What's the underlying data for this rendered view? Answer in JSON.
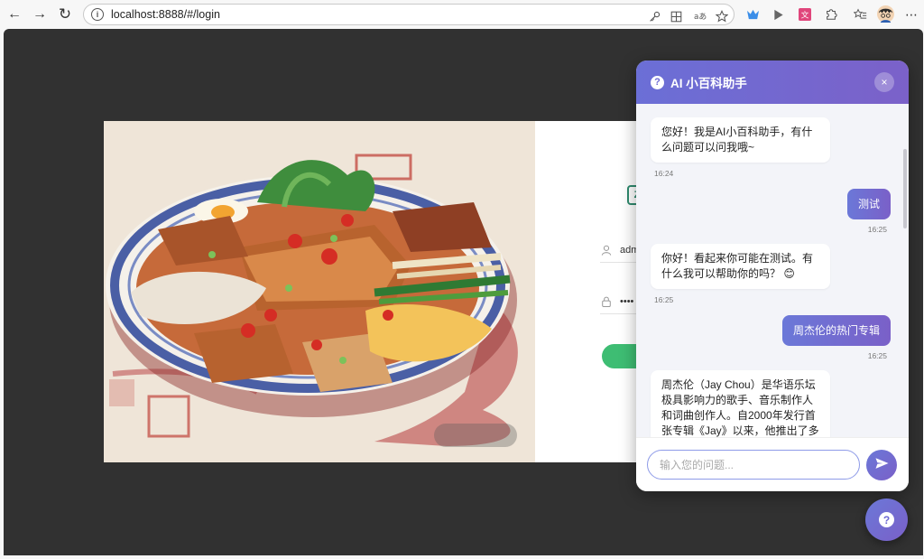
{
  "browser": {
    "url": "localhost:8888/#/login",
    "info_glyph": "i",
    "back_glyph": "←",
    "forward_glyph": "→",
    "reload_glyph": "↻",
    "menu_glyph": "⋯"
  },
  "login": {
    "logo_glyph": "Z",
    "username_value": "adm",
    "password_value": "••••"
  },
  "chat": {
    "header": {
      "help_glyph": "?",
      "title": "AI 小百科助手",
      "close_glyph": "×"
    },
    "messages": [
      {
        "role": "bot",
        "text": "您好！我是AI小百科助手，有什么问题可以问我哦~",
        "time": "16:24"
      },
      {
        "role": "user",
        "text": "测试",
        "time": "16:25"
      },
      {
        "role": "bot",
        "text": "你好！看起来你可能在测试。有什么我可以帮助你的吗？ 😊",
        "time": "16:25"
      },
      {
        "role": "user",
        "text": "周杰伦的热门专辑",
        "time": "16:25"
      },
      {
        "role": "bot",
        "text": "周杰伦（Jay Chou）是华语乐坛极具影响力的歌手、音乐制作人和词曲创作人。自2000年发行首张专辑《Jay》以来，他推出了多张广受好",
        "time": ""
      }
    ],
    "input_placeholder": "输入您的问题..."
  },
  "fab": {
    "glyph": "?"
  },
  "colors": {
    "accent_start": "#6b78d8",
    "accent_end": "#7a60c8",
    "login_button": "#3ebd73",
    "page_bg": "#313131"
  }
}
